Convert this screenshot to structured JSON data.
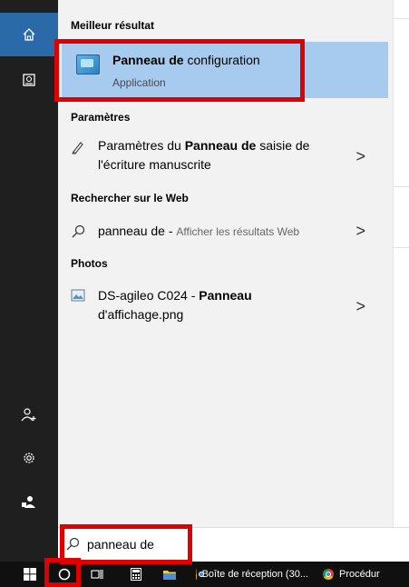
{
  "rail": {
    "items": [
      {
        "icon": "home-icon",
        "active": true
      },
      {
        "icon": "documents-icon",
        "active": false
      },
      {
        "icon": "add-user-icon",
        "active": false
      },
      {
        "icon": "gear-icon",
        "active": false
      },
      {
        "icon": "user-icon",
        "active": false
      }
    ]
  },
  "sections": {
    "best_match": "Meilleur résultat",
    "settings": "Paramètres",
    "web": "Rechercher sur le Web",
    "photos": "Photos"
  },
  "best_result": {
    "title_bold": "Panneau de",
    "title_rest": " configuration",
    "subtitle": "Application"
  },
  "settings_item": {
    "line1_pre": "Paramètres du ",
    "line1_bold": "Panneau de",
    "line1_post": " saisie de",
    "line2": "l'écriture manuscrite"
  },
  "web_item": {
    "query": "panneau de",
    "dash": " - ",
    "hint": "Afficher les résultats Web"
  },
  "photo_item": {
    "line1_pre": "DS-agileo C024 - ",
    "line1_bold": "Panneau",
    "line2": "d'affichage.png"
  },
  "chevron": ">",
  "search": {
    "query": "panneau de"
  },
  "taskbar": {
    "apps": [
      {
        "label": "Boîte de réception (30...",
        "icon": "chrome-icon"
      },
      {
        "label": "Procédur",
        "icon": "chrome-icon"
      }
    ]
  },
  "colors": {
    "rail_bg": "#1f1f1f",
    "rail_active": "#2b6aa8",
    "best_result_bg": "#a6cbee",
    "highlight": "#e00000"
  }
}
